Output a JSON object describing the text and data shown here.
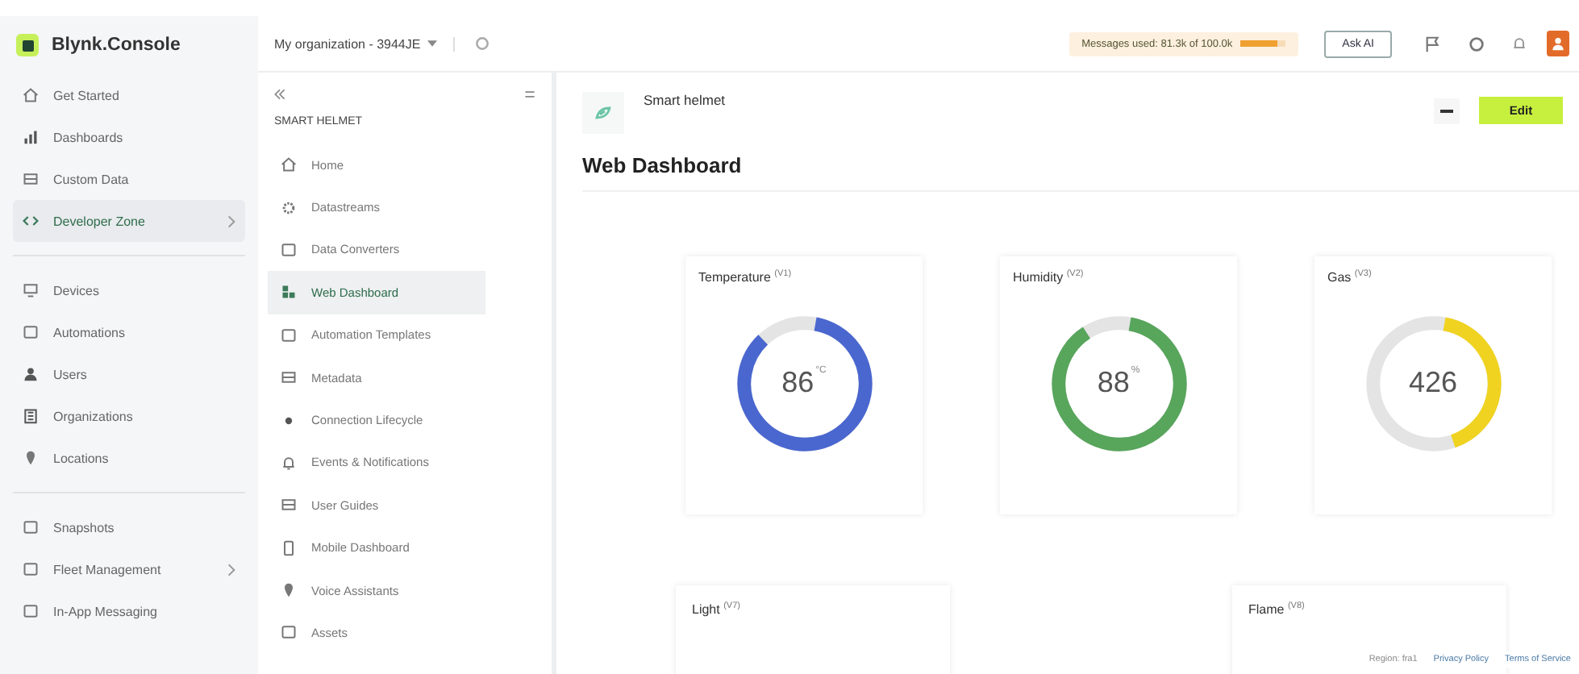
{
  "brand": {
    "name": "Blynk.Console"
  },
  "header": {
    "organization": "My organization - 3944JE",
    "usage": {
      "text": "Messages used: 81.3k of 100.0k",
      "level": 0.81
    },
    "ask_button": "Ask AI"
  },
  "sidebar": {
    "groups": [
      {
        "items": [
          {
            "label": "Get Started",
            "selected": false,
            "submenu": false
          },
          {
            "label": "Dashboards",
            "selected": false,
            "submenu": false
          },
          {
            "label": "Custom Data",
            "selected": false,
            "submenu": false
          },
          {
            "label": "Developer Zone",
            "selected": true,
            "submenu": true
          }
        ]
      },
      {
        "items": [
          {
            "label": "Devices",
            "selected": false,
            "submenu": false
          },
          {
            "label": "Automations",
            "selected": false,
            "submenu": false
          },
          {
            "label": "Users",
            "selected": false,
            "submenu": false
          },
          {
            "label": "Organizations",
            "selected": false,
            "submenu": false
          },
          {
            "label": "Locations",
            "selected": false,
            "submenu": false
          }
        ]
      },
      {
        "items": [
          {
            "label": "Snapshots",
            "selected": false,
            "submenu": false
          },
          {
            "label": "Fleet Management",
            "selected": false,
            "submenu": true
          },
          {
            "label": "In-App Messaging",
            "selected": false,
            "submenu": false
          }
        ]
      }
    ]
  },
  "template_menu": {
    "title": "SMART HELMET",
    "items": [
      {
        "label": "Home",
        "selected": false
      },
      {
        "label": "Datastreams",
        "selected": false
      },
      {
        "label": "Data Converters",
        "selected": false
      },
      {
        "label": "Web Dashboard",
        "selected": true
      },
      {
        "label": "Automation Templates",
        "selected": false
      },
      {
        "label": "Metadata",
        "selected": false
      },
      {
        "label": "Connection Lifecycle",
        "selected": false
      },
      {
        "label": "Events & Notifications",
        "selected": false
      },
      {
        "label": "User Guides",
        "selected": false
      },
      {
        "label": "Mobile Dashboard",
        "selected": false
      },
      {
        "label": "Voice Assistants",
        "selected": false
      },
      {
        "label": "Assets",
        "selected": false
      }
    ]
  },
  "template": {
    "name": "Smart helmet",
    "edit_button": "Edit"
  },
  "page_title": "Web Dashboard",
  "gauges": [
    {
      "label": "Temperature",
      "pin": "(V1)",
      "value": "86",
      "unit": "°C",
      "level": 0.85,
      "color": "#4a67cf"
    },
    {
      "label": "Humidity",
      "pin": "(V2)",
      "value": "88",
      "unit": "%",
      "level": 0.88,
      "color": "#58a55c"
    },
    {
      "label": "Gas",
      "pin": "(V3)",
      "value": "426",
      "level": 0.42,
      "color": "#f0d321"
    }
  ],
  "lower_widgets": [
    {
      "label": "Light",
      "pin": "(V7)"
    },
    {
      "label": "Flame",
      "pin": "(V8)"
    }
  ],
  "footer": {
    "region": "Region: fra1",
    "links": [
      "Privacy Policy",
      "Terms of Service"
    ]
  }
}
